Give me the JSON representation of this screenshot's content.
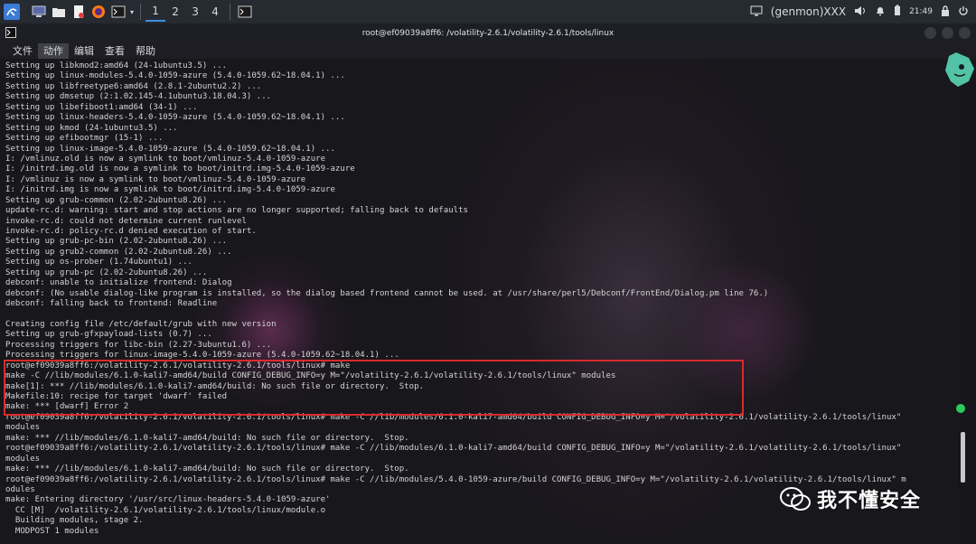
{
  "taskbar": {
    "workspaces": [
      "1",
      "2",
      "3",
      "4"
    ],
    "active_workspace": "1",
    "user_label": "(genmon)XXX",
    "clock": "21:49",
    "icons": [
      "kali-menu-icon",
      "desktop-icon",
      "files-icon",
      "text-editor-icon",
      "firefox-icon",
      "terminal-icon"
    ]
  },
  "window": {
    "title": "root@ef09039a8ff6: /volatility-2.6.1/volatility-2.6.1/tools/linux"
  },
  "menubar": {
    "items": [
      "文件",
      "动作",
      "编辑",
      "查看",
      "帮助"
    ]
  },
  "terminal": {
    "lines": [
      "Setting up libkmod2:amd64 (24-1ubuntu3.5) ...",
      "Setting up linux-modules-5.4.0-1059-azure (5.4.0-1059.62~18.04.1) ...",
      "Setting up libfreetype6:amd64 (2.8.1-2ubuntu2.2) ...",
      "Setting up dmsetup (2:1.02.145-4.1ubuntu3.18.04.3) ...",
      "Setting up libefiboot1:amd64 (34-1) ...",
      "Setting up linux-headers-5.4.0-1059-azure (5.4.0-1059.62~18.04.1) ...",
      "Setting up kmod (24-1ubuntu3.5) ...",
      "Setting up efibootmgr (15-1) ...",
      "Setting up linux-image-5.4.0-1059-azure (5.4.0-1059.62~18.04.1) ...",
      "I: /vmlinuz.old is now a symlink to boot/vmlinuz-5.4.0-1059-azure",
      "I: /initrd.img.old is now a symlink to boot/initrd.img-5.4.0-1059-azure",
      "I: /vmlinuz is now a symlink to boot/vmlinuz-5.4.0-1059-azure",
      "I: /initrd.img is now a symlink to boot/initrd.img-5.4.0-1059-azure",
      "Setting up grub-common (2.02-2ubuntu8.26) ...",
      "update-rc.d: warning: start and stop actions are no longer supported; falling back to defaults",
      "invoke-rc.d: could not determine current runlevel",
      "invoke-rc.d: policy-rc.d denied execution of start.",
      "Setting up grub-pc-bin (2.02-2ubuntu8.26) ...",
      "Setting up grub2-common (2.02-2ubuntu8.26) ...",
      "Setting up os-prober (1.74ubuntu1) ...",
      "Setting up grub-pc (2.02-2ubuntu8.26) ...",
      "debconf: unable to initialize frontend: Dialog",
      "debconf: (No usable dialog-like program is installed, so the dialog based frontend cannot be used. at /usr/share/perl5/Debconf/FrontEnd/Dialog.pm line 76.)",
      "debconf: falling back to frontend: Readline",
      "",
      "Creating config file /etc/default/grub with new version",
      "Setting up grub-gfxpayload-lists (0.7) ...",
      "Processing triggers for libc-bin (2.27-3ubuntu1.6) ...",
      "Processing triggers for linux-image-5.4.0-1059-azure (5.4.0-1059.62~18.04.1) ...",
      "root@ef09039a8ff6:/volatility-2.6.1/volatility-2.6.1/tools/linux# make",
      "make -C //lib/modules/6.1.0-kali7-amd64/build CONFIG_DEBUG_INFO=y M=\"/volatility-2.6.1/volatility-2.6.1/tools/linux\" modules",
      "make[1]: *** //lib/modules/6.1.0-kali7-amd64/build: No such file or directory.  Stop.",
      "Makefile:10: recipe for target 'dwarf' failed",
      "make: *** [dwarf] Error 2",
      "root@ef09039a8ff6:/volatility-2.6.1/volatility-2.6.1/tools/linux# make -C //lib/modules/6.1.0-kali7-amd64/build CONFIG_DEBUG_INFO=y M=\"/volatility-2.6.1/volatility-2.6.1/tools/linux\"",
      "modules",
      "make: *** //lib/modules/6.1.0-kali7-amd64/build: No such file or directory.  Stop.",
      "root@ef09039a8ff6:/volatility-2.6.1/volatility-2.6.1/tools/linux# make -C //lib/modules/6.1.0-kali7-amd64/build CONFIG_DEBUG_INFO=y M=\"/volatility-2.6.1/volatility-2.6.1/tools/linux\"",
      "modules",
      "make: *** //lib/modules/6.1.0-kali7-amd64/build: No such file or directory.  Stop.",
      "root@ef09039a8ff6:/volatility-2.6.1/volatility-2.6.1/tools/linux# make -C //lib/modules/5.4.0-1059-azure/build CONFIG_DEBUG_INFO=y M=\"/volatility-2.6.1/volatility-2.6.1/tools/linux\" m",
      "odules",
      "make: Entering directory '/usr/src/linux-headers-5.4.0-1059-azure'",
      "  CC [M]  /volatility-2.6.1/volatility-2.6.1/tools/linux/module.o",
      "  Building modules, stage 2.",
      "  MODPOST 1 modules"
    ]
  },
  "watermark": {
    "text": "我不懂安全"
  },
  "colors": {
    "highlight_box": "#d92b2b",
    "terminal_text": "#d4d4d4",
    "accent": "#3a8ee6"
  }
}
